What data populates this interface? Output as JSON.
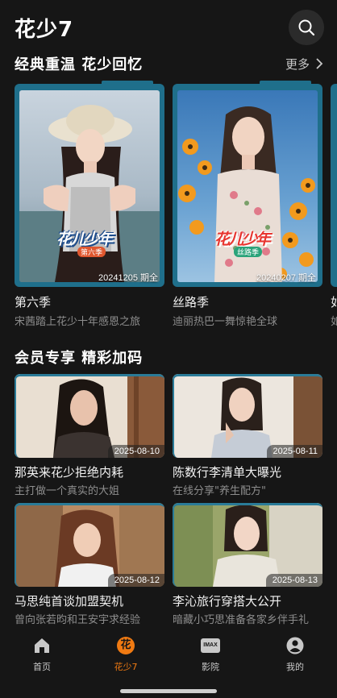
{
  "header": {
    "title": "花少7"
  },
  "section1": {
    "title": "经典重温 花少回忆",
    "more_label": "更多",
    "cards": [
      {
        "title": "第六季",
        "subtitle": "宋茜踏上花少十年感恩之旅",
        "date": "20241205 期全",
        "logo_text": "花儿少年",
        "logo_sub": "第六季"
      },
      {
        "title": "丝路季",
        "subtitle": "迪丽热巴一舞惊艳全球",
        "date": "20240207 期全",
        "logo_text": "花儿少年",
        "logo_sub": "丝路季"
      },
      {
        "title": "如",
        "subtitle": "如"
      }
    ]
  },
  "section2": {
    "title": "会员专享 精彩加码",
    "items": [
      {
        "title": "那英来花少拒绝内耗",
        "subtitle": "主打做一个真实的大姐",
        "date": "2025-08-10"
      },
      {
        "title": "陈数行李清单大曝光",
        "subtitle": "在线分享\"养生配方\"",
        "date": "2025-08-11"
      },
      {
        "title": "马思纯首谈加盟契机",
        "subtitle": "曾向张若昀和王安宇求经验",
        "date": "2025-08-12"
      },
      {
        "title": "李沁旅行穿搭大公开",
        "subtitle": "暗藏小巧思准备各家乡伴手礼",
        "date": "2025-08-13"
      }
    ]
  },
  "tabbar": {
    "items": [
      {
        "label": "首页",
        "icon": "home-icon"
      },
      {
        "label": "花少7",
        "icon": "flower-icon",
        "badge_char": "花",
        "active": true
      },
      {
        "label": "影院",
        "icon": "imax-icon",
        "badge_text": "IMAX"
      },
      {
        "label": "我的",
        "icon": "profile-icon"
      }
    ]
  },
  "colors": {
    "background": "#161616",
    "accent": "#f07a12",
    "frame": "#1f6f8b",
    "muted_text": "#8d8d8d"
  }
}
